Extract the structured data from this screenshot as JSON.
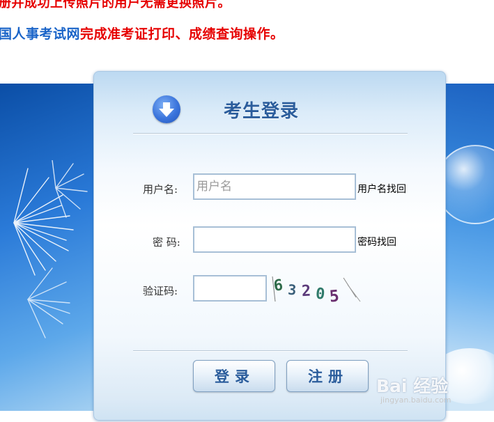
{
  "notices": {
    "line1": "册并成功上传照片的用户无需更换照片。",
    "line2_link": "国人事考试网",
    "line2_rest": "完成准考证打印、成绩查询操作。"
  },
  "login": {
    "title": "考生登录",
    "username_label": "用户名:",
    "username_placeholder": "用户名",
    "username_value": "",
    "recover_username": "用户名找回",
    "password_label": "密 码:",
    "password_value": "",
    "recover_password": "密码找回",
    "captcha_label": "验证码:",
    "captcha_value": "",
    "captcha_code": "63205",
    "login_button": "登录",
    "register_button": "注册"
  },
  "watermark": {
    "main": "Bai 经验",
    "sub": "jingyan.baidu.com"
  },
  "colors": {
    "notice_red": "#e60000",
    "notice_blue": "#1a64c8",
    "title_blue": "#2b5d9c"
  }
}
